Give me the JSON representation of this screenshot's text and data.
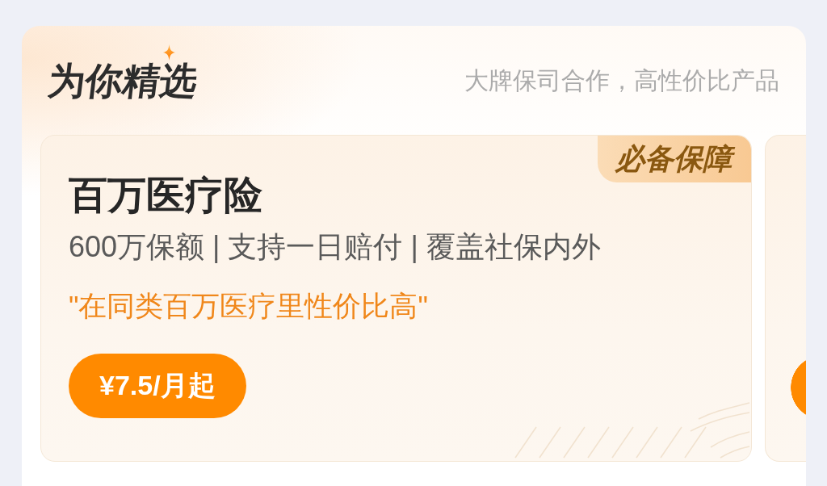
{
  "section": {
    "title": "为你精选",
    "subtitle": "大牌保司合作，高性价比产品"
  },
  "products": [
    {
      "kind": "full",
      "badge": "必备保障",
      "name": "百万医疗险",
      "features": "600万保额 | 支持一日赔付 | 覆盖社保内外",
      "quote": "\"在同类百万医疗里性价比高\"",
      "price": "¥7.5/月起"
    },
    {
      "kind": "peek"
    }
  ]
}
